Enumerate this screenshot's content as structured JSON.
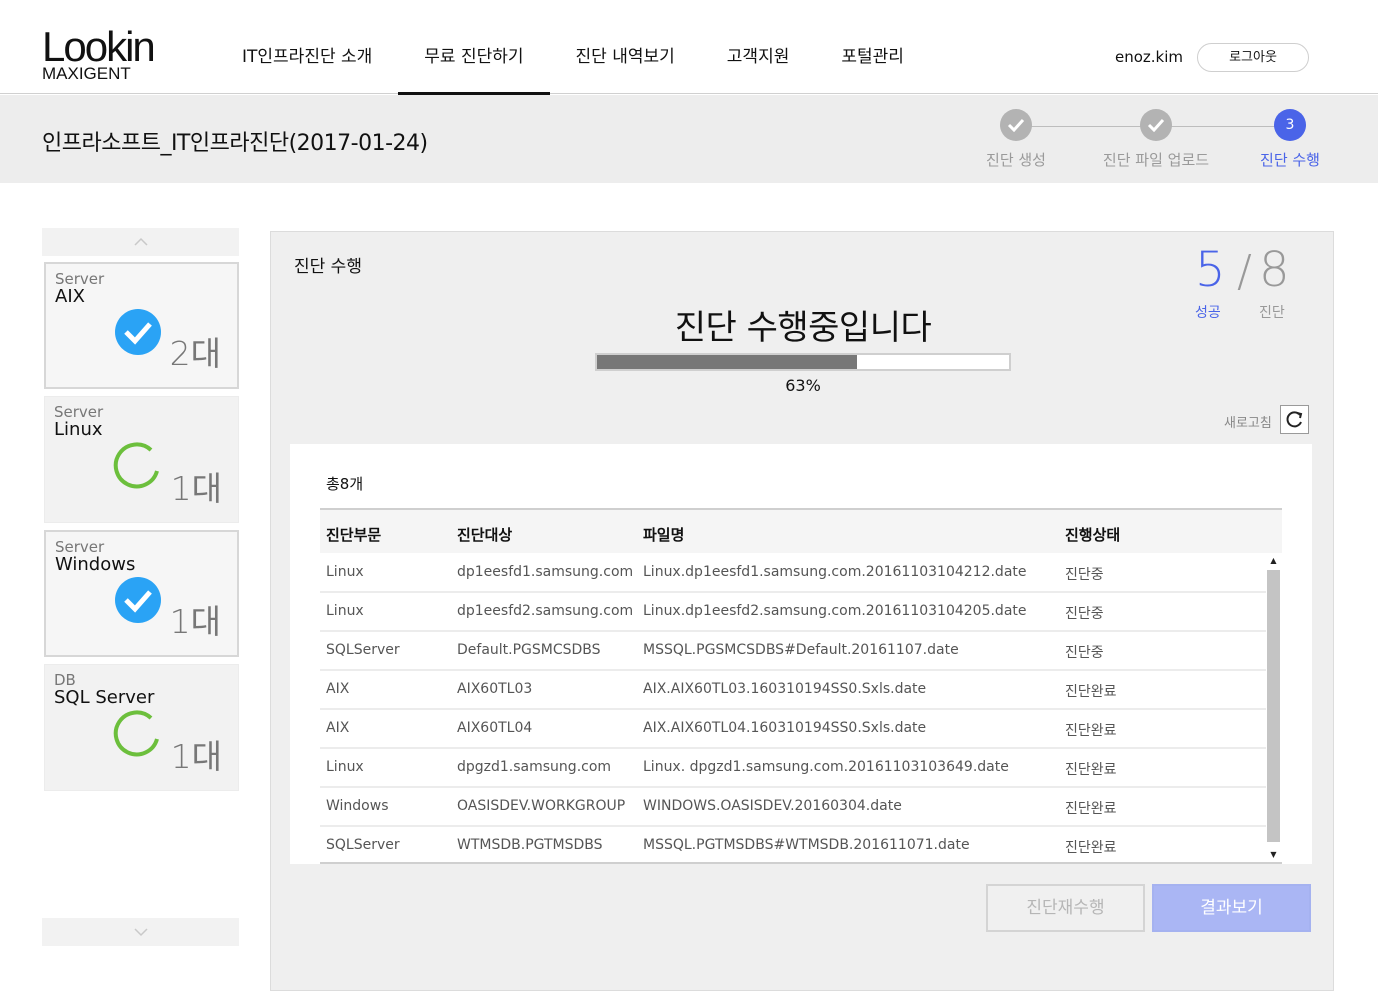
{
  "header": {
    "logo_main": "Lookin",
    "logo_sub": "MAXIGENT",
    "nav": [
      {
        "label": "IT인프라진단 소개",
        "active": false
      },
      {
        "label": "무료 진단하기",
        "active": true
      },
      {
        "label": "진단 내역보기",
        "active": false
      },
      {
        "label": "고객지원",
        "active": false
      },
      {
        "label": "포털관리",
        "active": false
      }
    ],
    "user": "enoz.kim",
    "logout_label": "로그아웃"
  },
  "titlebar": {
    "title": "인프라소프트_IT인프라진단(2017-01-24)",
    "steps": [
      {
        "number": "1",
        "label": "진단 생성",
        "status": "done"
      },
      {
        "number": "2",
        "label": "진단 파일 업로드",
        "status": "done"
      },
      {
        "number": "3",
        "label": "진단 수행",
        "status": "current"
      }
    ]
  },
  "sidebar": {
    "cards": [
      {
        "type": "Server",
        "name": "AIX",
        "count": "2대",
        "status": "complete",
        "selected": true
      },
      {
        "type": "Server",
        "name": "Linux",
        "count": "1대",
        "status": "in-progress",
        "selected": false
      },
      {
        "type": "Server",
        "name": "Windows",
        "count": "1대",
        "status": "complete",
        "selected": true
      },
      {
        "type": "DB",
        "name": "SQL Server",
        "count": "1대",
        "status": "in-progress",
        "selected": false
      }
    ]
  },
  "panel": {
    "title": "진단 수행",
    "counter": {
      "success": "5",
      "success_label": "성공",
      "total": "8",
      "total_label": "진단"
    },
    "status_message": "진단 수행중입니다",
    "progress": 0.63,
    "progress_text": "63%",
    "refresh_label": "새로고침",
    "total_text": "총8개",
    "table": {
      "columns": [
        "진단부문",
        "진단대상",
        "파일명",
        "진행상태"
      ],
      "rows": [
        [
          "Linux",
          "dp1eesfd1.samsung.com",
          "Linux.dp1eesfd1.samsung.com.20161103104212.date",
          "진단중"
        ],
        [
          "Linux",
          "dp1eesfd2.samsung.com",
          "Linux.dp1eesfd2.samsung.com.20161103104205.date",
          "진단중"
        ],
        [
          "SQLServer",
          "Default.PGSMCSDBS",
          "MSSQL.PGSMCSDBS#Default.20161107.date",
          "진단중"
        ],
        [
          "AIX",
          "AIX60TL03",
          "AIX.AIX60TL03.160310194SS0.Sxls.date",
          "진단완료"
        ],
        [
          "AIX",
          "AIX60TL04",
          "AIX.AIX60TL04.160310194SS0.Sxls.date",
          "진단완료"
        ],
        [
          "Linux",
          "dpgzd1.samsung.com",
          "Linux. dpgzd1.samsung.com.20161103103649.date",
          "진단완료"
        ],
        [
          "Windows",
          "OASISDEV.WORKGROUP",
          "WINDOWS.OASISDEV.20160304.date",
          "진단완료"
        ],
        [
          "SQLServer",
          "WTMSDB.PGTMSDBS",
          "MSSQL.PGTMSDBS#WTMSDB.201611071.date",
          "진단완료"
        ]
      ]
    },
    "rerun_label": "진단재수행",
    "result_label": "결과보기"
  },
  "colors": {
    "accent": "#4a64e8",
    "check_blue": "#2aa3f5",
    "progress_green": "#6cbf3c",
    "progress_fill": "#777777",
    "result_button": "#aab6f4"
  }
}
